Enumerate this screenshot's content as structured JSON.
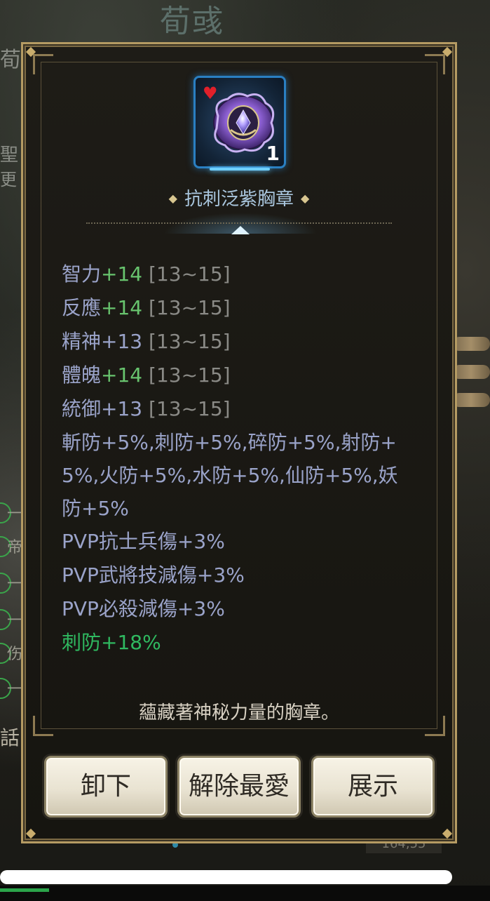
{
  "background": {
    "title": "荀彧",
    "side_chars": [
      "荀",
      "聖",
      "更"
    ],
    "list_items": [
      "一",
      "帝",
      "一",
      "一",
      "伤",
      "一"
    ],
    "chat_label": "話",
    "coordinates": "164,55"
  },
  "item": {
    "name": "抗刺泛紫胸章",
    "count": "1",
    "favorite": true,
    "icon": "purple-badge-icon",
    "frame_color": "#2a7fc2"
  },
  "stats": [
    {
      "name": "智力",
      "value": "+14",
      "range": "[13~15]",
      "highlight": true
    },
    {
      "name": "反應",
      "value": "+14",
      "range": "[13~15]",
      "highlight": true
    },
    {
      "name": "精神",
      "value": "+13",
      "range": "[13~15]",
      "highlight": false
    },
    {
      "name": "體魄",
      "value": "+14",
      "range": "[13~15]",
      "highlight": true
    },
    {
      "name": "統御",
      "value": "+13",
      "range": "[13~15]",
      "highlight": false
    }
  ],
  "resistances": {
    "line1": "斬防+5%,刺防+5%,碎防+5%,射防+",
    "line2": "5%,火防+5%,水防+5%,仙防+5%,妖",
    "line3": "防+5%"
  },
  "pvp": [
    "PVP抗士兵傷+3%",
    "PVP武將技減傷+3%",
    "PVP必殺減傷+3%"
  ],
  "special_stat": "刺防+18%",
  "description": "蘊藏著神秘力量的胸章。",
  "buttons": {
    "unequip": "卸下",
    "unfavorite": "解除最愛",
    "show": "展示"
  },
  "colors": {
    "stat_text": "#9aa3c9",
    "highlight_value": "#68c46e",
    "special_stat": "#2fb960",
    "item_name": "#a9c6de",
    "border_gold": "#b59b63"
  }
}
